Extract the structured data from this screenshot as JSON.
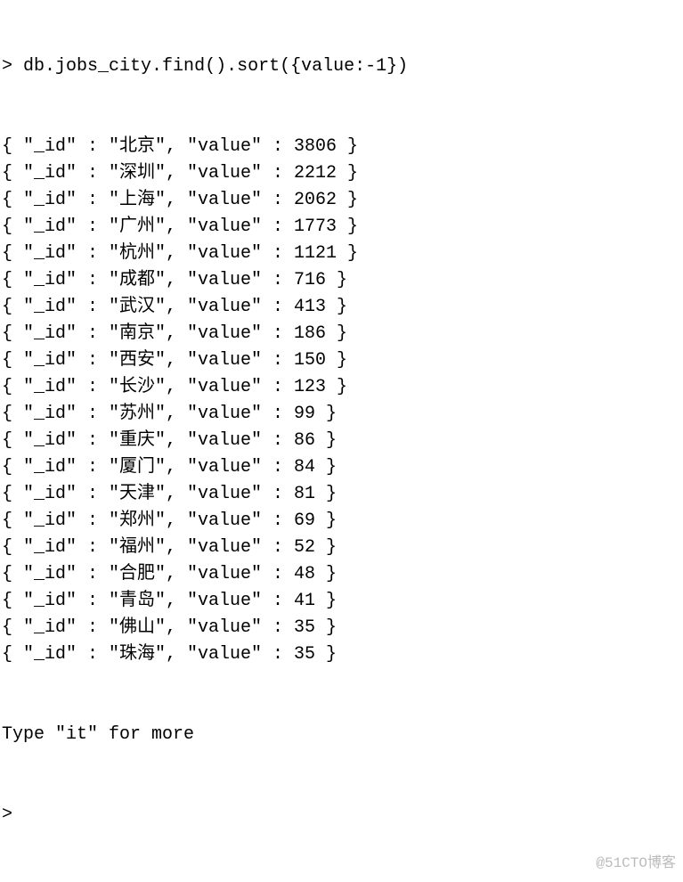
{
  "prompt_char": ">",
  "command": "db.jobs_city.find().sort({value:-1})",
  "id_key": "_id",
  "value_key": "value",
  "footer": "Type \"it\" for more",
  "watermark": "@51CTO博客",
  "chart_data": {
    "type": "table",
    "title": "db.jobs_city find() sorted by value desc",
    "columns": [
      "_id",
      "value"
    ],
    "rows": [
      {
        "_id": "北京",
        "value": 3806
      },
      {
        "_id": "深圳",
        "value": 2212
      },
      {
        "_id": "上海",
        "value": 2062
      },
      {
        "_id": "广州",
        "value": 1773
      },
      {
        "_id": "杭州",
        "value": 1121
      },
      {
        "_id": "成都",
        "value": 716
      },
      {
        "_id": "武汉",
        "value": 413
      },
      {
        "_id": "南京",
        "value": 186
      },
      {
        "_id": "西安",
        "value": 150
      },
      {
        "_id": "长沙",
        "value": 123
      },
      {
        "_id": "苏州",
        "value": 99
      },
      {
        "_id": "重庆",
        "value": 86
      },
      {
        "_id": "厦门",
        "value": 84
      },
      {
        "_id": "天津",
        "value": 81
      },
      {
        "_id": "郑州",
        "value": 69
      },
      {
        "_id": "福州",
        "value": 52
      },
      {
        "_id": "合肥",
        "value": 48
      },
      {
        "_id": "青岛",
        "value": 41
      },
      {
        "_id": "佛山",
        "value": 35
      },
      {
        "_id": "珠海",
        "value": 35
      }
    ]
  }
}
